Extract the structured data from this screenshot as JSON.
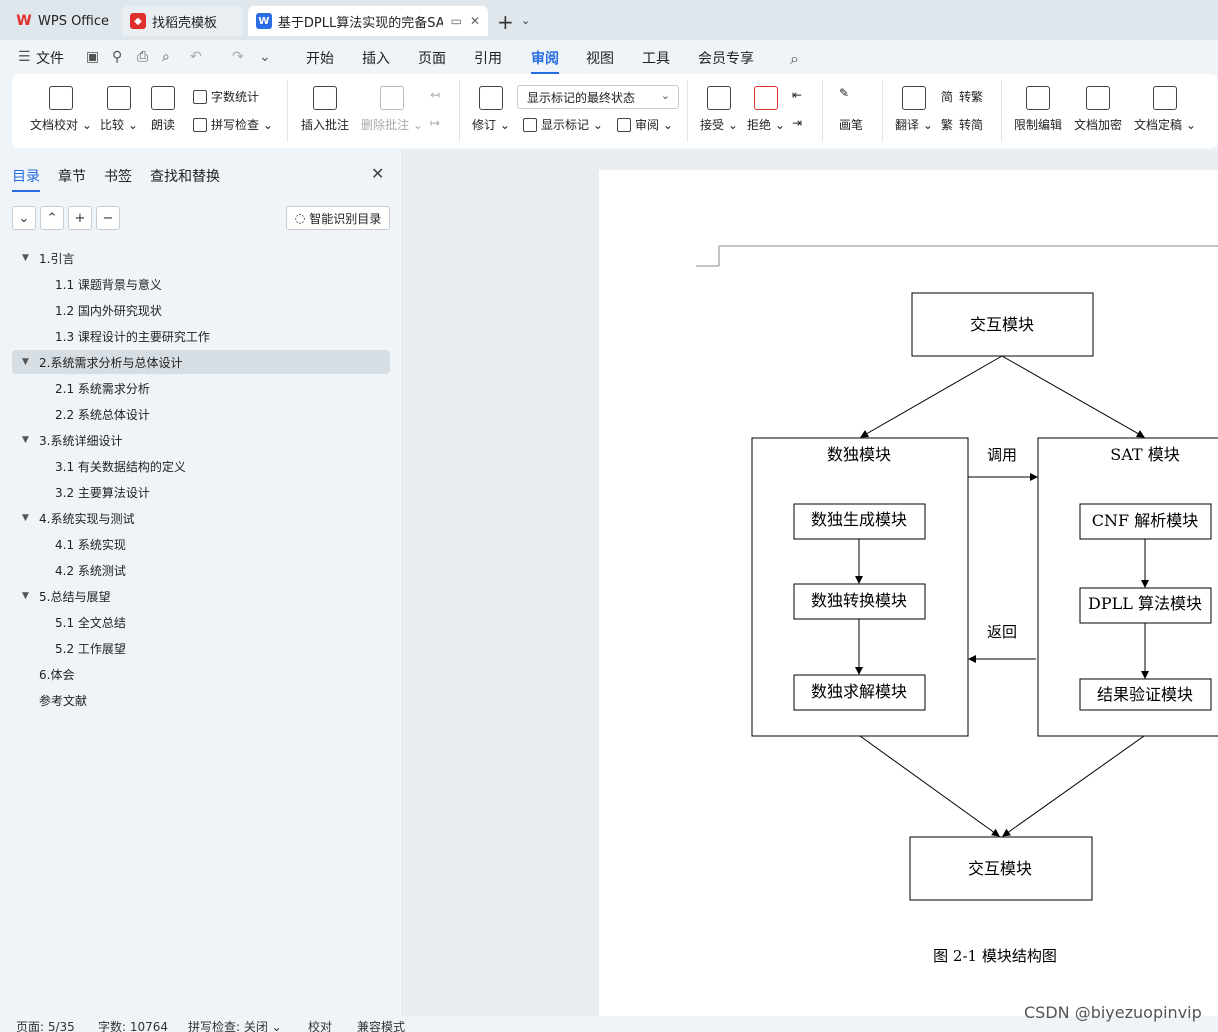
{
  "tabs": [
    {
      "label": "WPS Office",
      "icon": "wps-logo-icon",
      "color": "#e0302b"
    },
    {
      "label": "找稻壳模板",
      "icon": "docer-icon",
      "color": "#e0302b"
    },
    {
      "label": "基于DPLL算法实现的完备SAT",
      "icon": "word-doc-icon",
      "color": "#2a6de3"
    }
  ],
  "menu": {
    "file": "文件",
    "items": [
      "开始",
      "插入",
      "页面",
      "引用",
      "审阅",
      "视图",
      "工具",
      "会员专享"
    ],
    "active": "审阅"
  },
  "ribbon": {
    "doc_check": "文档校对",
    "compare": "比较",
    "read_aloud": "朗读",
    "word_count": "字数统计",
    "spell_check": "拼写检查",
    "insert_comment": "插入批注",
    "delete_comment": "删除批注",
    "track_changes": "修订",
    "display_state": "显示标记的最终状态",
    "show_markup": "显示标记",
    "review_pane": "审阅",
    "accept": "接受",
    "reject": "拒绝",
    "pen": "画笔",
    "translate": "翻译",
    "to_traditional": "转繁",
    "to_simplified": "转简",
    "simp_char": "简",
    "trad_char": "繁",
    "restrict_edit": "限制编辑",
    "encrypt": "文档加密",
    "finalize": "文档定稿"
  },
  "left_panel": {
    "tabs": [
      "目录",
      "章节",
      "书签",
      "查找和替换"
    ],
    "smart_toc": "智能识别目录",
    "toc": [
      {
        "label": "1.引言",
        "level": 1,
        "expanded": true
      },
      {
        "label": "1.1 课题背景与意义",
        "level": 2
      },
      {
        "label": "1.2 国内外研究现状",
        "level": 2
      },
      {
        "label": "1.3 课程设计的主要研究工作",
        "level": 2
      },
      {
        "label": "2.系统需求分析与总体设计",
        "level": 1,
        "expanded": true,
        "selected": true
      },
      {
        "label": "2.1 系统需求分析",
        "level": 2
      },
      {
        "label": "2.2 系统总体设计",
        "level": 2
      },
      {
        "label": "3.系统详细设计",
        "level": 1,
        "expanded": true
      },
      {
        "label": "3.1 有关数据结构的定义",
        "level": 2
      },
      {
        "label": "3.2 主要算法设计",
        "level": 2
      },
      {
        "label": "4.系统实现与测试",
        "level": 1,
        "expanded": true
      },
      {
        "label": "4.1 系统实现",
        "level": 2
      },
      {
        "label": "4.2 系统测试",
        "level": 2
      },
      {
        "label": "5.总结与展望",
        "level": 1,
        "expanded": true
      },
      {
        "label": "5.1 全文总结",
        "level": 2
      },
      {
        "label": "5.2 工作展望",
        "level": 2
      },
      {
        "label": "6.体会",
        "level": 1
      },
      {
        "label": "参考文献",
        "level": 1
      }
    ]
  },
  "diagram": {
    "top": "交互模块",
    "sudoku": "数独模块",
    "sudoku_gen": "数独生成模块",
    "sudoku_convert": "数独转换模块",
    "sudoku_solve": "数独求解模块",
    "sat": "SAT 模块",
    "cnf": "CNF 解析模块",
    "dpll": "DPLL 算法模块",
    "verify": "结果验证模块",
    "call": "调用",
    "return": "返回",
    "bottom": "交互模块",
    "caption": "图 2-1 模块结构图"
  },
  "status": {
    "page": "页面: 5/35",
    "words": "字数: 10764",
    "spell": "拼写检查: 关闭",
    "proof": "校对",
    "compat": "兼容模式"
  },
  "watermark": "CSDN @biyezuopinvip"
}
